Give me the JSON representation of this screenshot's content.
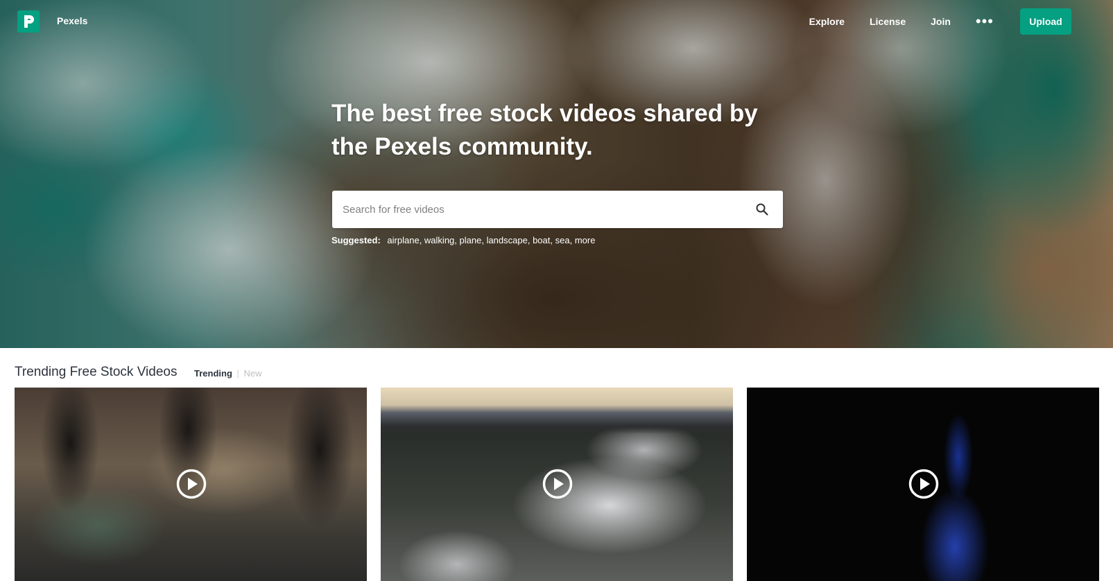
{
  "nav": {
    "brand": "Pexels",
    "links": [
      "Explore",
      "License",
      "Join"
    ],
    "more_label": "•••",
    "upload_label": "Upload"
  },
  "hero": {
    "headline": "The best free stock videos shared by the Pexels community.",
    "search_placeholder": "Search for free videos",
    "suggested_label": "Suggested:",
    "suggested_terms": [
      "airplane",
      "walking",
      "plane",
      "landscape",
      "boat",
      "sea",
      "more"
    ]
  },
  "section": {
    "title": "Trending Free Stock Videos",
    "tab_trending": "Trending",
    "tab_separator": "|",
    "tab_new": "New"
  },
  "colors": {
    "brand": "#05a081",
    "text": "#2c343e",
    "inactive_tab": "#c0c0c0"
  },
  "icons": {
    "logo": "pexels-logo-icon",
    "search": "search-icon",
    "more": "more-dots-icon",
    "play": "play-icon"
  }
}
